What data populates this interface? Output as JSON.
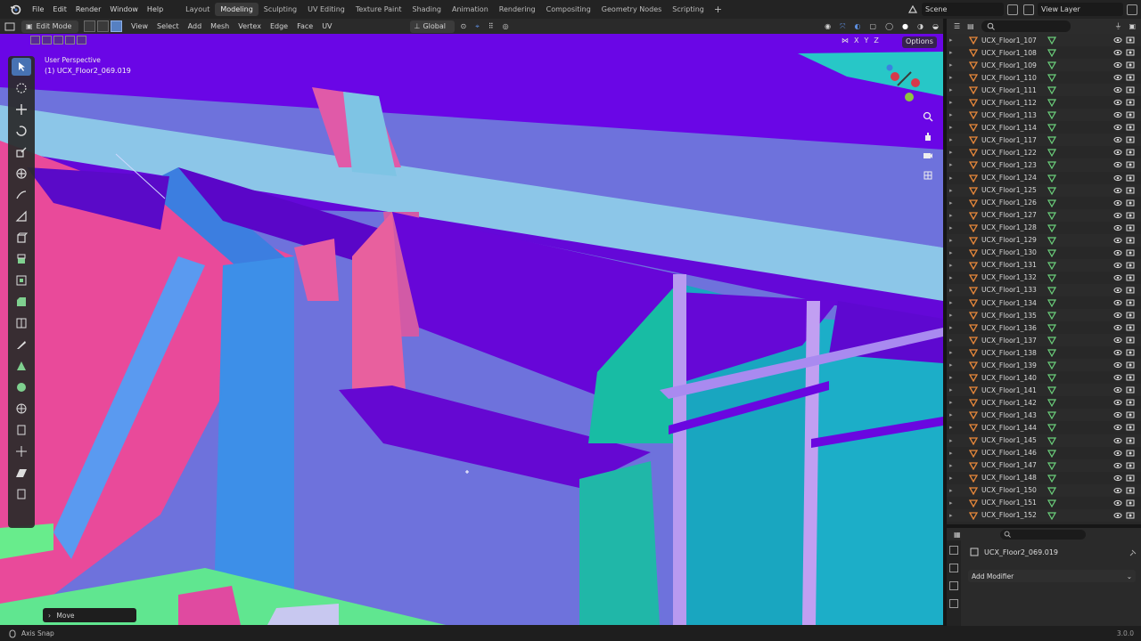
{
  "menu": [
    "File",
    "Edit",
    "Render",
    "Window",
    "Help"
  ],
  "workspaces": [
    {
      "label": "Layout",
      "active": false
    },
    {
      "label": "Modeling",
      "active": true
    },
    {
      "label": "Sculpting",
      "active": false
    },
    {
      "label": "UV Editing",
      "active": false
    },
    {
      "label": "Texture Paint",
      "active": false
    },
    {
      "label": "Shading",
      "active": false
    },
    {
      "label": "Animation",
      "active": false
    },
    {
      "label": "Rendering",
      "active": false
    },
    {
      "label": "Compositing",
      "active": false
    },
    {
      "label": "Geometry Nodes",
      "active": false
    },
    {
      "label": "Scripting",
      "active": false
    }
  ],
  "scene": {
    "name": "Scene"
  },
  "view_layer": {
    "name": "View Layer"
  },
  "viewport_header": {
    "mode": "Edit Mode",
    "menus": [
      "View",
      "Select",
      "Add",
      "Mesh",
      "Vertex",
      "Edge",
      "Face",
      "UV"
    ],
    "transform_orientation": "Global"
  },
  "viewport": {
    "view_name": "User Perspective",
    "object_label": "(1) UCX_Floor2_069.019",
    "axis_lock": [
      "X",
      "Y",
      "Z"
    ],
    "options_label": "Options",
    "last_operator": "Move"
  },
  "outliner": {
    "items": [
      "UCX_Floor1_107",
      "UCX_Floor1_108",
      "UCX_Floor1_109",
      "UCX_Floor1_110",
      "UCX_Floor1_111",
      "UCX_Floor1_112",
      "UCX_Floor1_113",
      "UCX_Floor1_114",
      "UCX_Floor1_117",
      "UCX_Floor1_122",
      "UCX_Floor1_123",
      "UCX_Floor1_124",
      "UCX_Floor1_125",
      "UCX_Floor1_126",
      "UCX_Floor1_127",
      "UCX_Floor1_128",
      "UCX_Floor1_129",
      "UCX_Floor1_130",
      "UCX_Floor1_131",
      "UCX_Floor1_132",
      "UCX_Floor1_133",
      "UCX_Floor1_134",
      "UCX_Floor1_135",
      "UCX_Floor1_136",
      "UCX_Floor1_137",
      "UCX_Floor1_138",
      "UCX_Floor1_139",
      "UCX_Floor1_140",
      "UCX_Floor1_141",
      "UCX_Floor1_142",
      "UCX_Floor1_143",
      "UCX_Floor1_144",
      "UCX_Floor1_145",
      "UCX_Floor1_146",
      "UCX_Floor1_147",
      "UCX_Floor1_148",
      "UCX_Floor1_150",
      "UCX_Floor1_151",
      "UCX_Floor1_152"
    ]
  },
  "properties": {
    "object_name": "UCX_Floor2_069.019",
    "add_modifier": "Add Modifier"
  },
  "statusbar": {
    "hint": "Axis Snap",
    "version": "3.0.0"
  },
  "colors": {
    "accent_blue": "#4772b3",
    "object_orange": "#e8883a",
    "mesh_green": "#6bd07b"
  }
}
